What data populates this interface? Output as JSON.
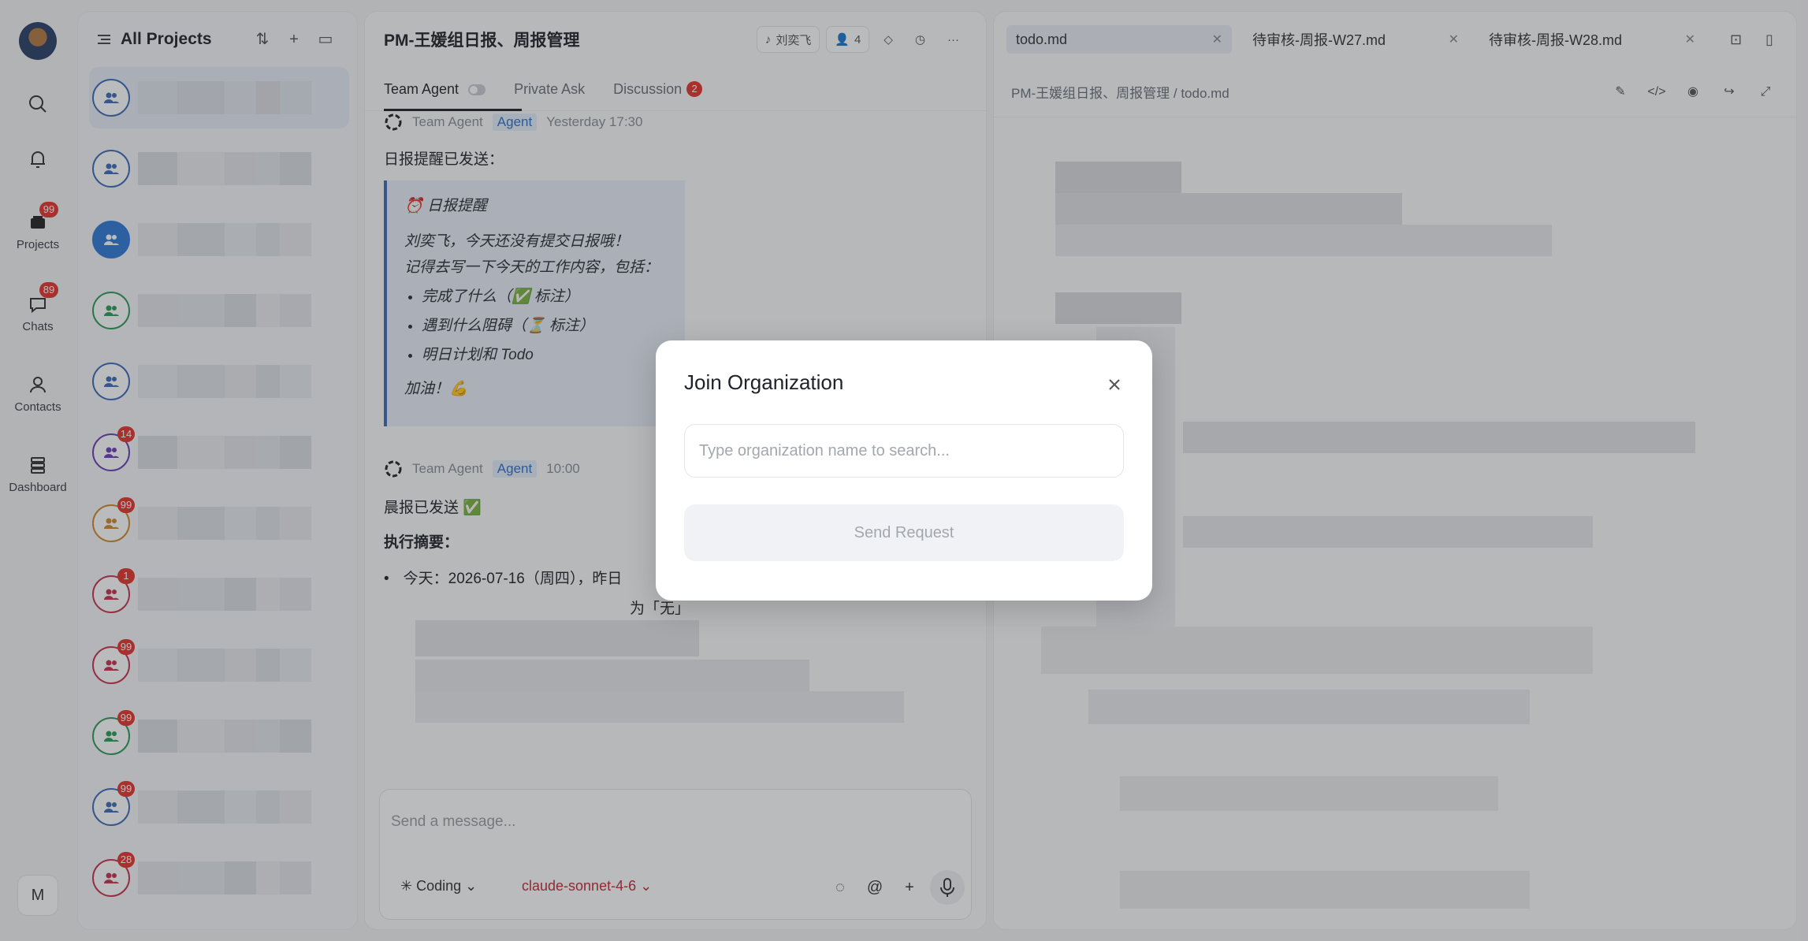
{
  "rail": {
    "items": [
      {
        "label": "",
        "icon": "search-icon"
      },
      {
        "label": "",
        "icon": "bell-icon"
      },
      {
        "label": "Projects",
        "icon": "folder-icon",
        "badge": "99"
      },
      {
        "label": "Chats",
        "icon": "chat-icon",
        "badge": "89"
      },
      {
        "label": "Contacts",
        "icon": "user-icon"
      },
      {
        "label": "Dashboard",
        "icon": "layers-icon"
      }
    ],
    "bottom_label": "M"
  },
  "projects": {
    "title": "All Projects",
    "badges": [
      "",
      "",
      "",
      "",
      "",
      "14",
      "99",
      "1",
      "99",
      "99",
      "99",
      "28"
    ]
  },
  "chat": {
    "title": "PM-王媛组日报、周报管理",
    "header_user": "刘奕飞",
    "member_count": "4",
    "tabs": {
      "team_agent": "Team Agent",
      "private_ask": "Private Ask",
      "discussion": "Discussion",
      "discussion_count": "2"
    },
    "msg1": {
      "author": "Team Agent",
      "tag": "Agent",
      "time": "Yesterday 17:30",
      "intro": "日报提醒已发送：",
      "quote_title": "⏰ 日报提醒",
      "quote_line1": "刘奕飞，今天还没有提交日报哦！",
      "quote_line2": "记得去写一下今天的工作内容，包括：",
      "quote_items": [
        "完成了什么（✅ 标注）",
        "遇到什么阻碍（⏳ 标注）",
        "明日计划和 Todo"
      ],
      "quote_end": "加油！💪"
    },
    "msg2": {
      "author": "Team Agent",
      "tag": "Agent",
      "time": "10:00",
      "intro": "晨报已发送 ✅",
      "summary": "执行摘要：",
      "bullet1": "今天：2026-07-16（周四），昨日",
      "bullet2": "为「无」"
    },
    "composer": {
      "placeholder": "Send a message...",
      "mode": "Coding",
      "model": "claude-sonnet-4-6"
    }
  },
  "doc": {
    "tabs": [
      "todo.md",
      "待审核-周报-W27.md",
      "待审核-周报-W28.md"
    ],
    "breadcrumb": "PM-王媛组日报、周报管理 / todo.md"
  },
  "modal": {
    "title": "Join Organization",
    "search_placeholder": "Type organization name to search...",
    "send_label": "Send Request"
  }
}
